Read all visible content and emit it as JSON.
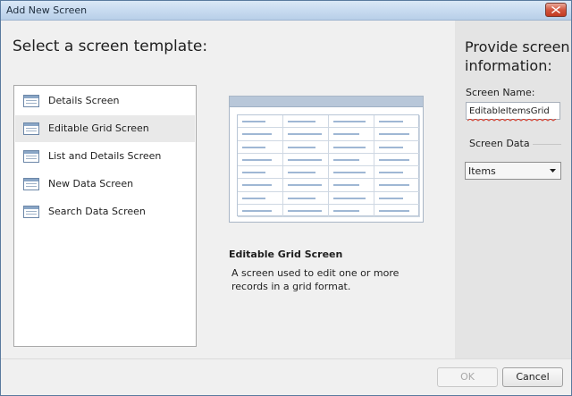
{
  "window": {
    "title": "Add New Screen"
  },
  "left": {
    "heading": "Select a screen template:",
    "templates": [
      {
        "label": "Details Screen",
        "selected": false
      },
      {
        "label": "Editable Grid Screen",
        "selected": true
      },
      {
        "label": "List and Details Screen",
        "selected": false
      },
      {
        "label": "New Data Screen",
        "selected": false
      },
      {
        "label": "Search Data Screen",
        "selected": false
      }
    ]
  },
  "preview": {
    "name": "Editable Grid Screen",
    "description": "A screen used to edit one or more records in a grid format."
  },
  "right": {
    "heading": "Provide screen information:",
    "screen_name_label": "Screen Name:",
    "screen_name_value": "EditableItemsGrid",
    "screen_data_label": "Screen Data",
    "screen_data_value": "Items"
  },
  "footer": {
    "ok_label": "OK",
    "ok_enabled": false,
    "cancel_label": "Cancel"
  },
  "colors": {
    "title_bar": "#c8dbf0",
    "close_button": "#c23b22",
    "selection": "#e9e9e9",
    "right_pane": "#e4e4e4"
  },
  "icons": {
    "template_item": "screen-template-icon",
    "close": "close-icon",
    "dropdown": "dropdown-arrow-icon"
  }
}
